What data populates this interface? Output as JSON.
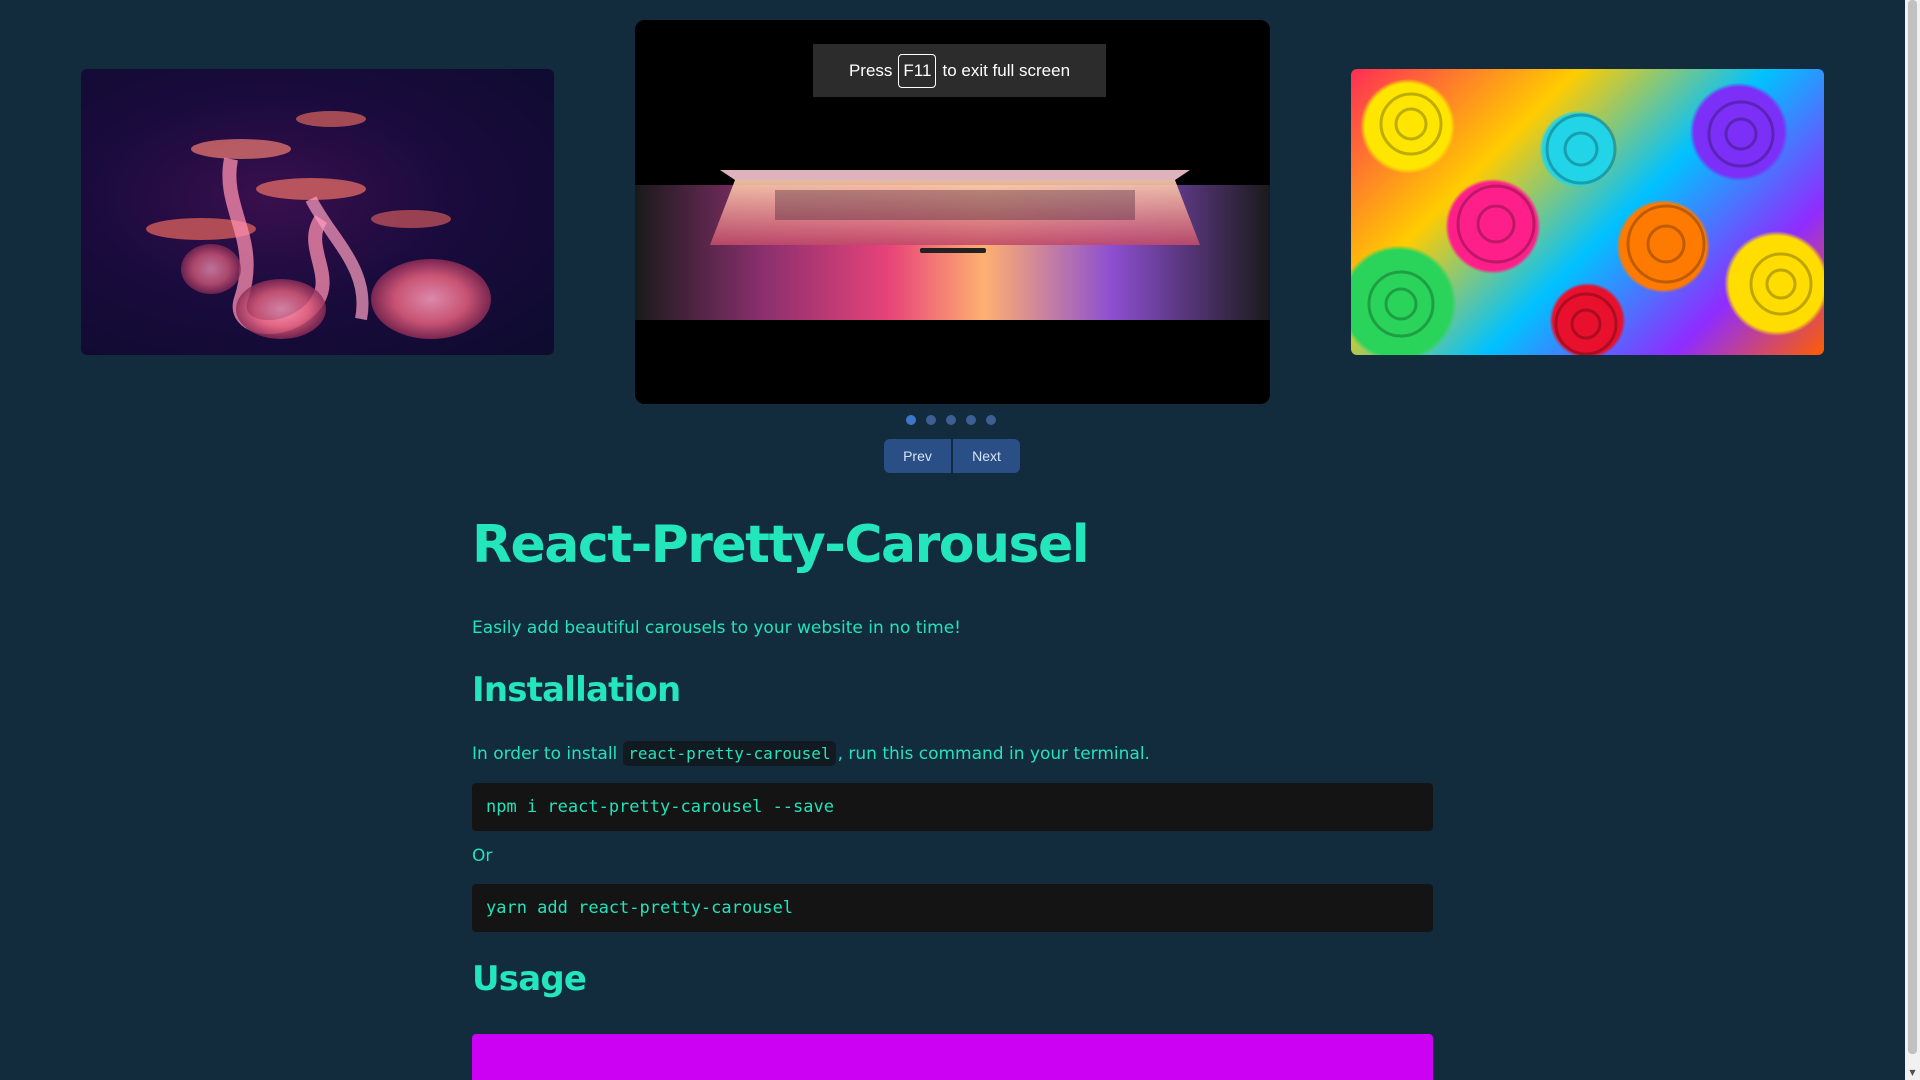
{
  "carousel": {
    "slides": [
      {
        "name": "jellyfish",
        "description_icon": "jellyfish-image"
      },
      {
        "name": "laptop",
        "description_icon": "laptop-image"
      },
      {
        "name": "rainbow-roses",
        "description_icon": "roses-image"
      }
    ],
    "dots_count": 5,
    "active_dot": 1,
    "prev_label": "Prev",
    "next_label": "Next"
  },
  "fullscreen_notice": {
    "before": "Press",
    "key": "F11",
    "after": "to exit full screen"
  },
  "content": {
    "title": "React-Pretty-Carousel",
    "tagline": "Easily add beautiful carousels to your website in no time!",
    "installation_heading": "Installation",
    "install_intro_before": "In order to install",
    "install_package": "react-pretty-carousel",
    "install_intro_after": ", run this command in your terminal.",
    "npm_command": "npm i react-pretty-carousel --save",
    "or_text": "Or",
    "yarn_command": "yarn add react-pretty-carousel",
    "usage_heading": "Usage"
  },
  "colors": {
    "background": "#122c3d",
    "accent_text": "#22e3bb",
    "code_background": "#141414",
    "usage_block": "#cc00f2",
    "button": "#2a4f86"
  }
}
